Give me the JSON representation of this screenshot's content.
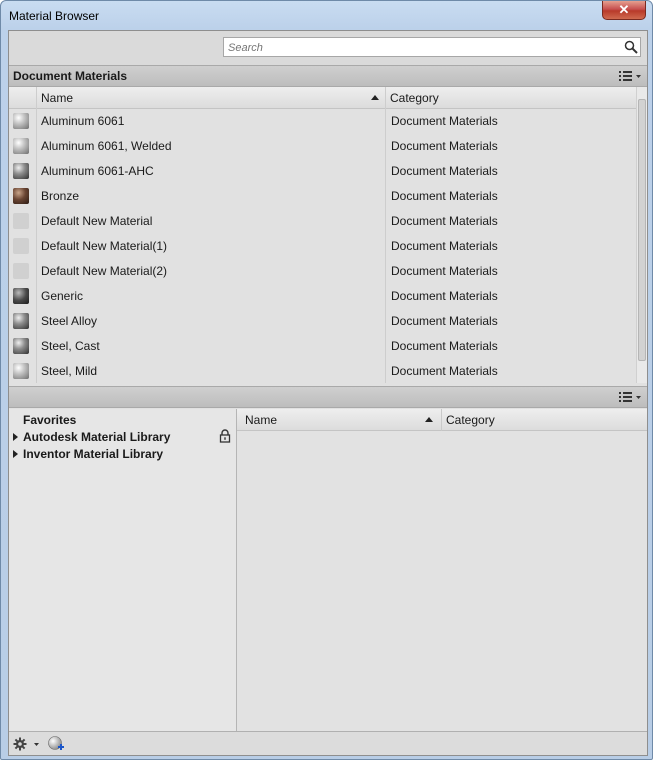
{
  "window": {
    "title": "Material Browser",
    "close_glyph": "✕"
  },
  "search": {
    "placeholder": "Search",
    "icon": "search-icon"
  },
  "document_section": {
    "title": "Document Materials",
    "view_icon": "list-view-icon"
  },
  "upper_table": {
    "columns": {
      "name": "Name",
      "category": "Category"
    },
    "rows": [
      {
        "name": "Aluminum 6061",
        "category": "Document Materials",
        "thumb": "sphere-metal"
      },
      {
        "name": "Aluminum 6061, Welded",
        "category": "Document Materials",
        "thumb": "sphere-metal"
      },
      {
        "name": "Aluminum 6061-AHC",
        "category": "Document Materials",
        "thumb": "sphere-metal-dark"
      },
      {
        "name": "Bronze",
        "category": "Document Materials",
        "thumb": "sphere-bronze"
      },
      {
        "name": "Default New Material",
        "category": "Document Materials",
        "thumb": "blank"
      },
      {
        "name": "Default New Material(1)",
        "category": "Document Materials",
        "thumb": "blank"
      },
      {
        "name": "Default New Material(2)",
        "category": "Document Materials",
        "thumb": "blank"
      },
      {
        "name": "Generic",
        "category": "Document Materials",
        "thumb": "sphere-dark"
      },
      {
        "name": "Steel Alloy",
        "category": "Document Materials",
        "thumb": "sphere-metal-dark"
      },
      {
        "name": "Steel, Cast",
        "category": "Document Materials",
        "thumb": "sphere-metal-dark"
      },
      {
        "name": "Steel, Mild",
        "category": "Document Materials",
        "thumb": "sphere-metal"
      }
    ]
  },
  "library_tree": {
    "items": [
      {
        "label": "Favorites",
        "expandable": false
      },
      {
        "label": "Autodesk Material Library",
        "expandable": true,
        "locked": true
      },
      {
        "label": "Inventor Material Library",
        "expandable": true
      }
    ]
  },
  "lower_table": {
    "columns": {
      "name": "Name",
      "category": "Category"
    }
  },
  "footer": {
    "settings_icon": "gear-icon",
    "add_library_icon": "globe-add-icon"
  }
}
